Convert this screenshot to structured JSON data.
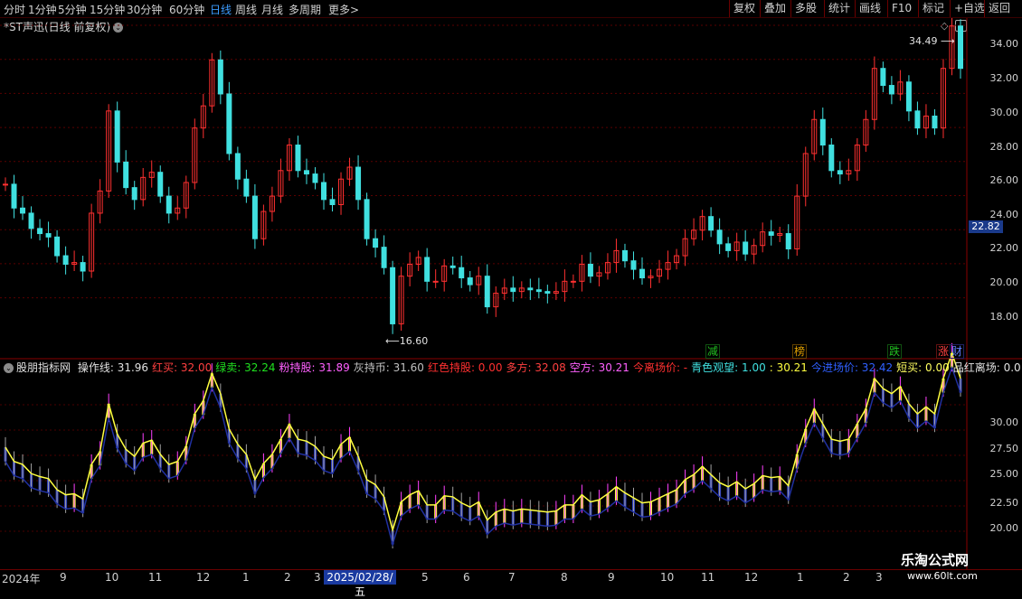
{
  "toolbar": {
    "periods": [
      "分时",
      "1分钟",
      "5分钟",
      "15分钟",
      "30分钟",
      "60分钟",
      "日线",
      "周线",
      "月线",
      "多周期",
      "更多"
    ],
    "active_period": "日线",
    "more_arrow": ">",
    "right_buttons": [
      "复权",
      "叠加",
      "多股",
      "统计",
      "画线",
      "F10",
      "标记",
      "+自选",
      "返回"
    ]
  },
  "chart_title": "*ST声迅(日线 前复权)",
  "price_axis": [
    "34.00",
    "32.00",
    "30.00",
    "28.00",
    "26.00",
    "24.00",
    "22.00",
    "20.00",
    "18.00"
  ],
  "current_price": "22.82",
  "high_marker": "34.49",
  "low_marker": "16.60",
  "event_tags": [
    {
      "text": "减",
      "color": "#20c020"
    },
    {
      "text": "榜",
      "color": "#e0a000"
    },
    {
      "text": "跌",
      "color": "#20c020"
    },
    {
      "text": "涨",
      "color": "#ff4040"
    },
    {
      "text": "财",
      "color": "#6080ff"
    }
  ],
  "indicator": {
    "name": "股朋指标网",
    "fields": [
      {
        "text": "操作线: 31.96",
        "color": "#e0e0e0"
      },
      {
        "text": "红买: 32.00",
        "color": "#ff4040"
      },
      {
        "text": "绿卖: 32.24",
        "color": "#20e020"
      },
      {
        "text": "粉持股: 31.89",
        "color": "#ff60ff"
      },
      {
        "text": "灰持币: 31.60",
        "color": "#c0c0c0"
      },
      {
        "text": "红色持股: 0.00",
        "color": "#ff3030"
      },
      {
        "text": "多方: 32.08",
        "color": "#ff4040"
      },
      {
        "text": "空方: 30.21",
        "color": "#ff60ff"
      },
      {
        "text": "今离场价: -",
        "color": "#ff3030"
      },
      {
        "text": "青色观望: 1.00",
        "color": "#40e0e0"
      },
      {
        "text": ": 30.21",
        "color": "#ffff40"
      },
      {
        "text": "今进场价: 32.42",
        "color": "#3060ff"
      },
      {
        "text": "短买: 0.00",
        "color": "#ffff60"
      },
      {
        "text": "品红离场: 0.0",
        "color": "#e0e0e0"
      }
    ],
    "axis": [
      "30.00",
      "27.50",
      "25.00",
      "22.50",
      "20.00"
    ]
  },
  "date_axis": {
    "labels": [
      "2024年",
      "9",
      "10",
      "11",
      "12",
      "1",
      "2",
      "3",
      "4",
      "5",
      "6",
      "7",
      "8",
      "9",
      "10",
      "11",
      "12",
      "1",
      "2",
      "3"
    ],
    "highlight": "2025/02/28/五"
  },
  "watermark": {
    "title": "乐淘公式网",
    "url": "www.60lt.com"
  },
  "chart_data": {
    "type": "candlestick",
    "price_axis_range": [
      16.6,
      34.49
    ],
    "series": [
      {
        "values": [
          25.2,
          23.8,
          23.5,
          22.6,
          22.3,
          22.1,
          21.0,
          20.5,
          20.6,
          20.1,
          23.5,
          24.8,
          29.5,
          26.5,
          25.0,
          24.3,
          25.6,
          25.9,
          24.5,
          23.5,
          23.8,
          25.3,
          28.5,
          29.8,
          32.5,
          30.5,
          27.0,
          25.5,
          24.5,
          22.0,
          23.6,
          24.5,
          26.0,
          27.5,
          26.0,
          25.8,
          25.3,
          24.3,
          24.0,
          25.5,
          26.2,
          24.3,
          22.0,
          21.5,
          20.3,
          17.0,
          19.8,
          20.5,
          20.9,
          19.5,
          19.5,
          20.4,
          20.3,
          19.7,
          19.3,
          19.8,
          18.0,
          18.8,
          19.1,
          18.9,
          19.1,
          19.0,
          18.9,
          18.8,
          18.9,
          19.5,
          19.5,
          20.5,
          19.8,
          20.0,
          20.6,
          21.3,
          20.7,
          20.2,
          19.7,
          19.8,
          20.2,
          20.6,
          21.0,
          22.0,
          22.5,
          23.3,
          22.5,
          21.7,
          21.3,
          21.8,
          21.1,
          21.6,
          22.4,
          22.2,
          22.3,
          21.4,
          24.5,
          27.0,
          29.0,
          27.5,
          26.0,
          25.8,
          26.0,
          27.5,
          29.0,
          32.0,
          31.0,
          30.5,
          31.2,
          29.5,
          28.5,
          29.2,
          28.5,
          32.0,
          34.49,
          32.0
        ]
      }
    ]
  }
}
